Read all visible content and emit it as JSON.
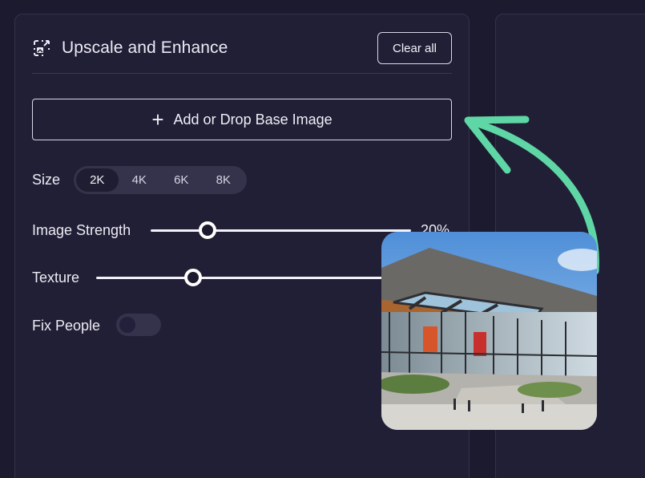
{
  "header": {
    "title": "Upscale and Enhance",
    "clear_label": "Clear all"
  },
  "add_image": {
    "label": "Add or Drop Base Image"
  },
  "size": {
    "label": "Size",
    "options": [
      "2K",
      "4K",
      "6K",
      "8K"
    ],
    "selected": "2K"
  },
  "image_strength": {
    "label": "Image Strength",
    "value_text": "20%",
    "value": 0.2
  },
  "texture": {
    "label": "Texture"
  },
  "fix_people": {
    "label": "Fix People",
    "on": false
  },
  "colors": {
    "accent_arrow": "#5fd6a5",
    "background": "#1c1a2e",
    "panel": "#211f35"
  }
}
